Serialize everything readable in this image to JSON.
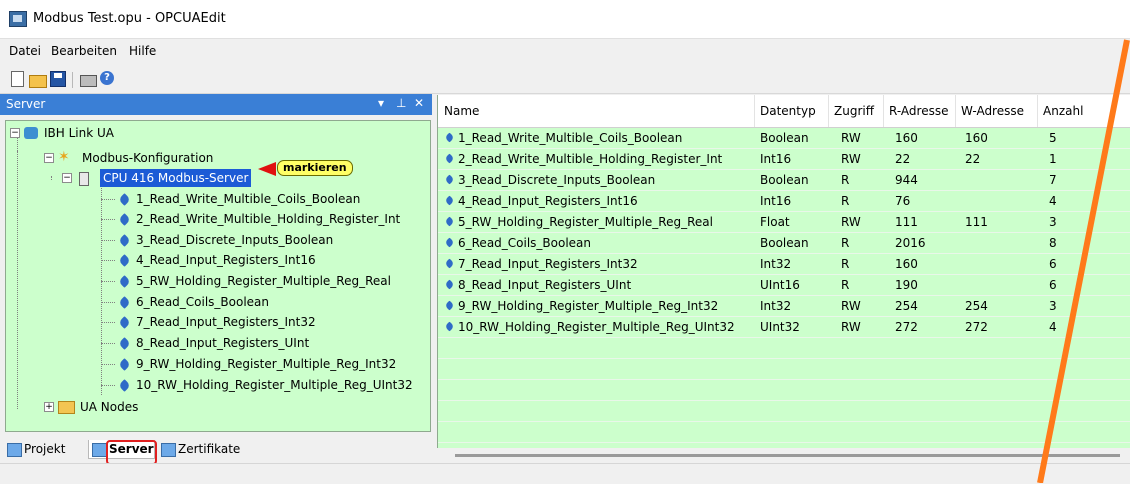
{
  "window": {
    "title": "Modbus Test.opu - OPCUAEdit"
  },
  "menu": {
    "items": [
      "Datei",
      "Bearbeiten",
      "Hilfe"
    ]
  },
  "toolbar": {
    "icons": [
      "new-file-icon",
      "open-folder-icon",
      "save-icon",
      "print-icon",
      "help-icon"
    ]
  },
  "server_panel": {
    "title": "Server",
    "controls": {
      "dropdown": "▾",
      "pin": "⊥",
      "close": "✕"
    },
    "tree": {
      "root": "IBH Link UA",
      "config": "Modbus-Konfiguration",
      "cpu": "CPU 416 Modbus-Server",
      "callout": "markieren",
      "items": [
        "1_Read_Write_Multible_Coils_Boolean",
        "2_Read_Write_Multible_Holding_Register_Int",
        "3_Read_Discrete_Inputs_Boolean",
        "4_Read_Input_Registers_Int16",
        "5_RW_Holding_Register_Multiple_Reg_Real",
        "6_Read_Coils_Boolean",
        "7_Read_Input_Registers_Int32",
        "8_Read_Input_Registers_UInt",
        "9_RW_Holding_Register_Multiple_Reg_Int32",
        "10_RW_Holding_Register_Multiple_Reg_UInt32"
      ],
      "ua_nodes": "UA Nodes"
    },
    "tabs": [
      "Projekt",
      "Server",
      "Zertifikate"
    ]
  },
  "grid": {
    "columns": [
      "Name",
      "Datentyp",
      "Zugriff",
      "R-Adresse",
      "W-Adresse",
      "Anzahl"
    ],
    "rows": [
      [
        "1_Read_Write_Multible_Coils_Boolean",
        "Boolean",
        "RW",
        "160",
        "160",
        "5"
      ],
      [
        "2_Read_Write_Multible_Holding_Register_Int",
        "Int16",
        "RW",
        "22",
        "22",
        "1"
      ],
      [
        "3_Read_Discrete_Inputs_Boolean",
        "Boolean",
        "R",
        "944",
        "",
        "7"
      ],
      [
        "4_Read_Input_Registers_Int16",
        "Int16",
        "R",
        "76",
        "",
        "4"
      ],
      [
        "5_RW_Holding_Register_Multiple_Reg_Real",
        "Float",
        "RW",
        "111",
        "111",
        "3"
      ],
      [
        "6_Read_Coils_Boolean",
        "Boolean",
        "R",
        "2016",
        "",
        "8"
      ],
      [
        "7_Read_Input_Registers_Int32",
        "Int32",
        "R",
        "160",
        "",
        "6"
      ],
      [
        "8_Read_Input_Registers_UInt",
        "UInt16",
        "R",
        "190",
        "",
        "6"
      ],
      [
        "9_RW_Holding_Register_Multiple_Reg_Int32",
        "Int32",
        "RW",
        "254",
        "254",
        "3"
      ],
      [
        "10_RW_Holding_Register_Multiple_Reg_UInt32",
        "UInt32",
        "RW",
        "272",
        "272",
        "4"
      ]
    ]
  },
  "colors": {
    "panel_bg": "#ccffcc",
    "selection": "#1c5bd6",
    "header_blue": "#3a7fd6",
    "annotation_orange": "#ff7a1a",
    "annotation_red": "#e02020"
  }
}
